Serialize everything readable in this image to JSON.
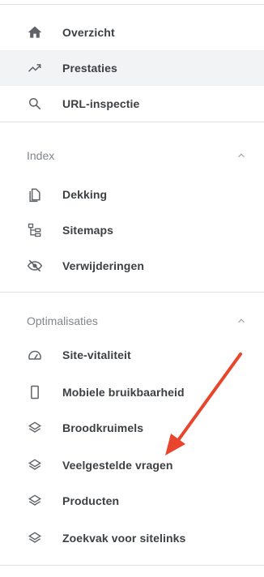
{
  "top_items": [
    {
      "label": "Overzicht",
      "icon": "home-icon"
    },
    {
      "label": "Prestaties",
      "icon": "trending-up-icon",
      "active": true
    },
    {
      "label": "URL-inspectie",
      "icon": "search-icon"
    }
  ],
  "index_section": {
    "title": "Index",
    "expanded": true,
    "items": [
      {
        "label": "Dekking",
        "icon": "copy-pages-icon"
      },
      {
        "label": "Sitemaps",
        "icon": "sitemap-icon"
      },
      {
        "label": "Verwijderingen",
        "icon": "eye-off-icon"
      }
    ]
  },
  "optimization_section": {
    "title": "Optimalisaties",
    "expanded": true,
    "items": [
      {
        "label": "Site-vitaliteit",
        "icon": "speedometer-icon"
      },
      {
        "label": "Mobiele bruikbaarheid",
        "icon": "phone-icon"
      },
      {
        "label": "Broodkruimels",
        "icon": "layers-icon"
      },
      {
        "label": "Veelgestelde vragen",
        "icon": "layers-icon"
      },
      {
        "label": "Producten",
        "icon": "layers-icon"
      },
      {
        "label": "Zoekvak voor sitelinks",
        "icon": "layers-icon"
      }
    ]
  },
  "colors": {
    "active_background": "#f1f3f4",
    "icon": "#5f6368",
    "label": "#3c4043",
    "section_title": "#80868b",
    "annotation_arrow": "#e8452c"
  },
  "annotation": {
    "icon": "red-arrow-icon",
    "points_to": "Veelgestelde vragen"
  }
}
